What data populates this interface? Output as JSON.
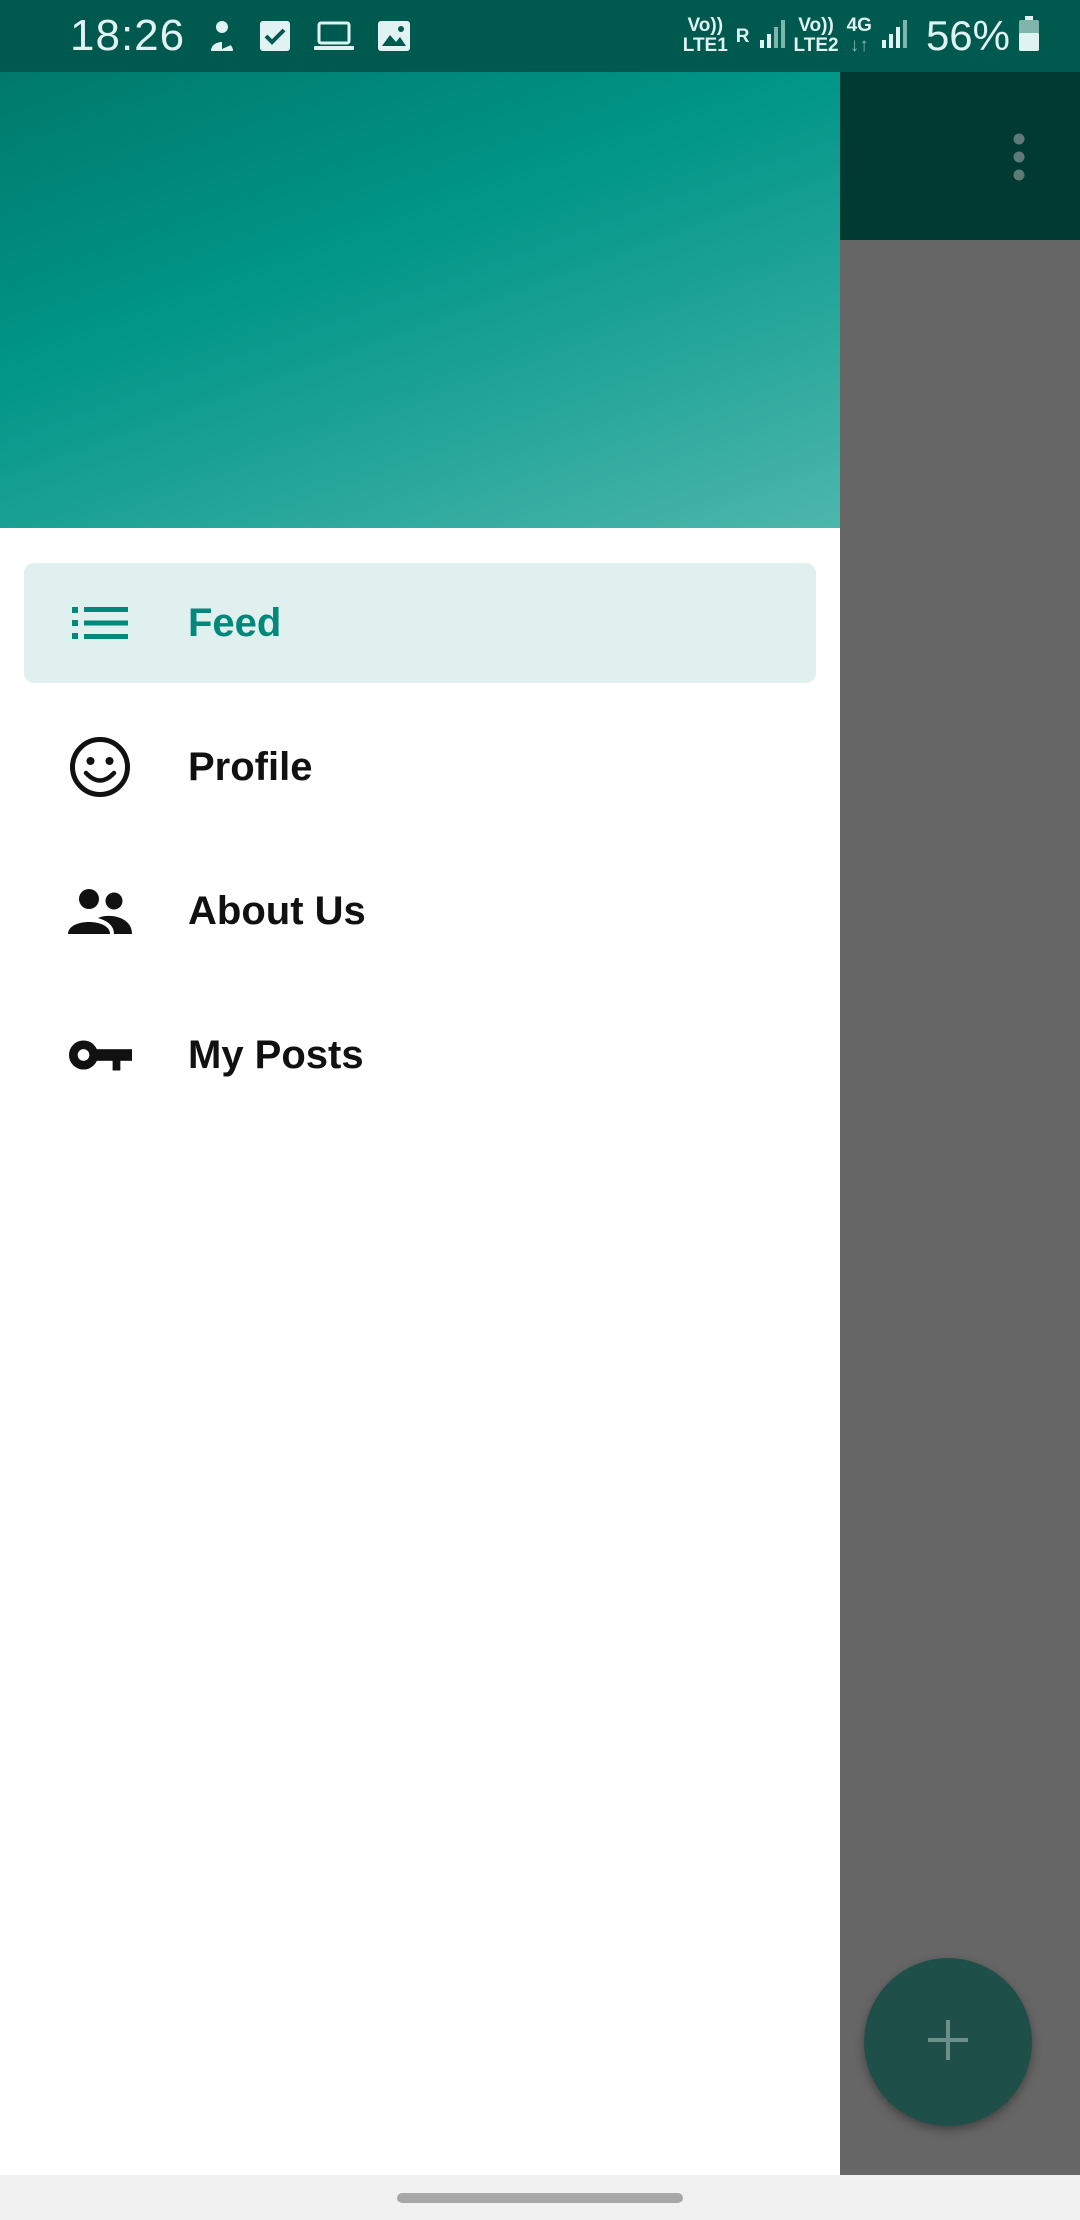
{
  "status_bar": {
    "time": "18:26",
    "left_icons": [
      "pie-person-icon",
      "checkbox-icon",
      "laptop-icon",
      "image-icon"
    ],
    "sim1": {
      "line1": "Vo))",
      "line2": "LTE1",
      "roaming": "R"
    },
    "sim2": {
      "line1": "Vo))",
      "line2": "LTE2",
      "network": "4G"
    },
    "battery_percent": "56%",
    "colors": {
      "background": "#00594f",
      "text": "#e0f2f1"
    }
  },
  "app": {
    "toolbar_color": "#003a33",
    "overflow_menu_icon": "more-vert-icon",
    "fab_icon": "plus-icon",
    "fab_color": "#1f4f49"
  },
  "drawer": {
    "header_gradient": [
      "#00796b",
      "#009688",
      "#4db6ac"
    ],
    "items": [
      {
        "label": "Feed",
        "icon": "list-icon",
        "selected": true
      },
      {
        "label": "Profile",
        "icon": "smiley-icon",
        "selected": false
      },
      {
        "label": "About Us",
        "icon": "people-icon",
        "selected": false
      },
      {
        "label": "My Posts",
        "icon": "key-icon",
        "selected": false
      }
    ],
    "accent_color": "#00897b",
    "selected_background": "#e0f0ef"
  }
}
